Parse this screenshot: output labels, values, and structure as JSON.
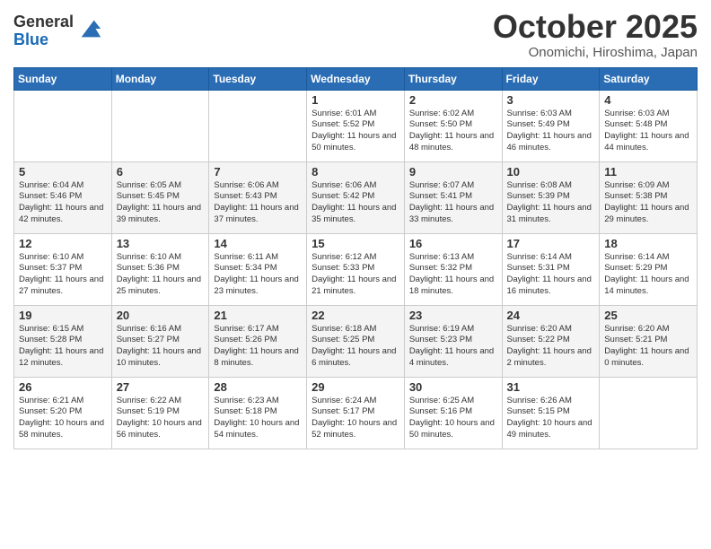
{
  "header": {
    "logo_general": "General",
    "logo_blue": "Blue",
    "month_title": "October 2025",
    "location": "Onomichi, Hiroshima, Japan"
  },
  "weekdays": [
    "Sunday",
    "Monday",
    "Tuesday",
    "Wednesday",
    "Thursday",
    "Friday",
    "Saturday"
  ],
  "weeks": [
    [
      {
        "day": "",
        "info": ""
      },
      {
        "day": "",
        "info": ""
      },
      {
        "day": "",
        "info": ""
      },
      {
        "day": "1",
        "info": "Sunrise: 6:01 AM\nSunset: 5:52 PM\nDaylight: 11 hours\nand 50 minutes."
      },
      {
        "day": "2",
        "info": "Sunrise: 6:02 AM\nSunset: 5:50 PM\nDaylight: 11 hours\nand 48 minutes."
      },
      {
        "day": "3",
        "info": "Sunrise: 6:03 AM\nSunset: 5:49 PM\nDaylight: 11 hours\nand 46 minutes."
      },
      {
        "day": "4",
        "info": "Sunrise: 6:03 AM\nSunset: 5:48 PM\nDaylight: 11 hours\nand 44 minutes."
      }
    ],
    [
      {
        "day": "5",
        "info": "Sunrise: 6:04 AM\nSunset: 5:46 PM\nDaylight: 11 hours\nand 42 minutes."
      },
      {
        "day": "6",
        "info": "Sunrise: 6:05 AM\nSunset: 5:45 PM\nDaylight: 11 hours\nand 39 minutes."
      },
      {
        "day": "7",
        "info": "Sunrise: 6:06 AM\nSunset: 5:43 PM\nDaylight: 11 hours\nand 37 minutes."
      },
      {
        "day": "8",
        "info": "Sunrise: 6:06 AM\nSunset: 5:42 PM\nDaylight: 11 hours\nand 35 minutes."
      },
      {
        "day": "9",
        "info": "Sunrise: 6:07 AM\nSunset: 5:41 PM\nDaylight: 11 hours\nand 33 minutes."
      },
      {
        "day": "10",
        "info": "Sunrise: 6:08 AM\nSunset: 5:39 PM\nDaylight: 11 hours\nand 31 minutes."
      },
      {
        "day": "11",
        "info": "Sunrise: 6:09 AM\nSunset: 5:38 PM\nDaylight: 11 hours\nand 29 minutes."
      }
    ],
    [
      {
        "day": "12",
        "info": "Sunrise: 6:10 AM\nSunset: 5:37 PM\nDaylight: 11 hours\nand 27 minutes."
      },
      {
        "day": "13",
        "info": "Sunrise: 6:10 AM\nSunset: 5:36 PM\nDaylight: 11 hours\nand 25 minutes."
      },
      {
        "day": "14",
        "info": "Sunrise: 6:11 AM\nSunset: 5:34 PM\nDaylight: 11 hours\nand 23 minutes."
      },
      {
        "day": "15",
        "info": "Sunrise: 6:12 AM\nSunset: 5:33 PM\nDaylight: 11 hours\nand 21 minutes."
      },
      {
        "day": "16",
        "info": "Sunrise: 6:13 AM\nSunset: 5:32 PM\nDaylight: 11 hours\nand 18 minutes."
      },
      {
        "day": "17",
        "info": "Sunrise: 6:14 AM\nSunset: 5:31 PM\nDaylight: 11 hours\nand 16 minutes."
      },
      {
        "day": "18",
        "info": "Sunrise: 6:14 AM\nSunset: 5:29 PM\nDaylight: 11 hours\nand 14 minutes."
      }
    ],
    [
      {
        "day": "19",
        "info": "Sunrise: 6:15 AM\nSunset: 5:28 PM\nDaylight: 11 hours\nand 12 minutes."
      },
      {
        "day": "20",
        "info": "Sunrise: 6:16 AM\nSunset: 5:27 PM\nDaylight: 11 hours\nand 10 minutes."
      },
      {
        "day": "21",
        "info": "Sunrise: 6:17 AM\nSunset: 5:26 PM\nDaylight: 11 hours\nand 8 minutes."
      },
      {
        "day": "22",
        "info": "Sunrise: 6:18 AM\nSunset: 5:25 PM\nDaylight: 11 hours\nand 6 minutes."
      },
      {
        "day": "23",
        "info": "Sunrise: 6:19 AM\nSunset: 5:23 PM\nDaylight: 11 hours\nand 4 minutes."
      },
      {
        "day": "24",
        "info": "Sunrise: 6:20 AM\nSunset: 5:22 PM\nDaylight: 11 hours\nand 2 minutes."
      },
      {
        "day": "25",
        "info": "Sunrise: 6:20 AM\nSunset: 5:21 PM\nDaylight: 11 hours\nand 0 minutes."
      }
    ],
    [
      {
        "day": "26",
        "info": "Sunrise: 6:21 AM\nSunset: 5:20 PM\nDaylight: 10 hours\nand 58 minutes."
      },
      {
        "day": "27",
        "info": "Sunrise: 6:22 AM\nSunset: 5:19 PM\nDaylight: 10 hours\nand 56 minutes."
      },
      {
        "day": "28",
        "info": "Sunrise: 6:23 AM\nSunset: 5:18 PM\nDaylight: 10 hours\nand 54 minutes."
      },
      {
        "day": "29",
        "info": "Sunrise: 6:24 AM\nSunset: 5:17 PM\nDaylight: 10 hours\nand 52 minutes."
      },
      {
        "day": "30",
        "info": "Sunrise: 6:25 AM\nSunset: 5:16 PM\nDaylight: 10 hours\nand 50 minutes."
      },
      {
        "day": "31",
        "info": "Sunrise: 6:26 AM\nSunset: 5:15 PM\nDaylight: 10 hours\nand 49 minutes."
      },
      {
        "day": "",
        "info": ""
      }
    ]
  ]
}
